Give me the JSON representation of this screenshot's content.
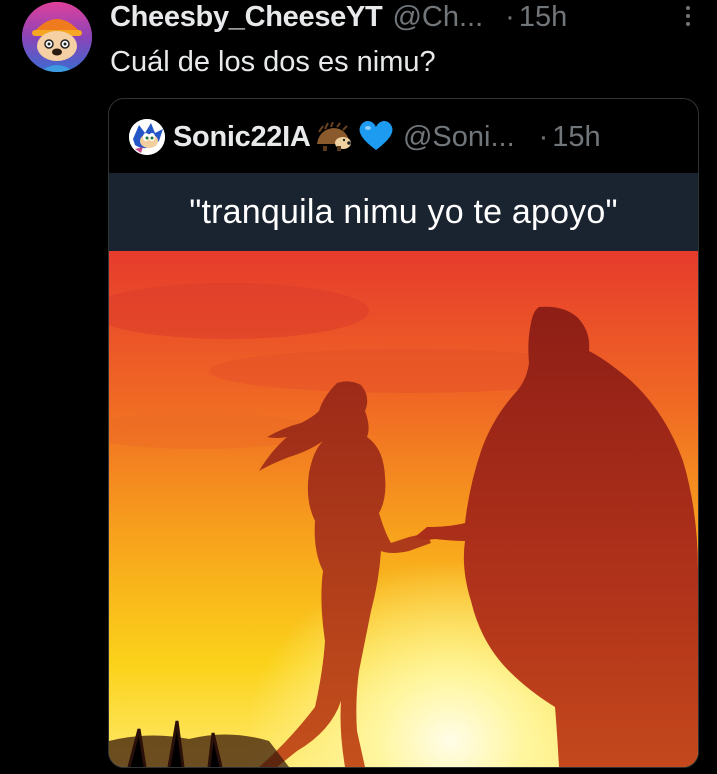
{
  "tweet": {
    "display_name": "Cheesby_CheeseYT",
    "handle": "@Ch...",
    "separator": "·",
    "time": "15h",
    "text": "Cuál de los dos es nimu?",
    "avatar_icon": "parappa-avatar-icon",
    "more_icon": "more-vertical-icon"
  },
  "quote": {
    "display_name": "Sonic22IA",
    "emoji": "🦔💙",
    "handle": "@Soni...",
    "separator": "·",
    "time": "15h",
    "avatar_icon": "sonic-avatar-icon"
  },
  "meme": {
    "caption": "\"tranquila nimu yo te apoyo\"",
    "image_subject": "sunset-silhouettes-image"
  },
  "colors": {
    "background": "#000000",
    "text_primary": "#e7e9ea",
    "text_secondary": "#71767b",
    "border": "#2f3336",
    "caption_bg": "#1a2330"
  }
}
